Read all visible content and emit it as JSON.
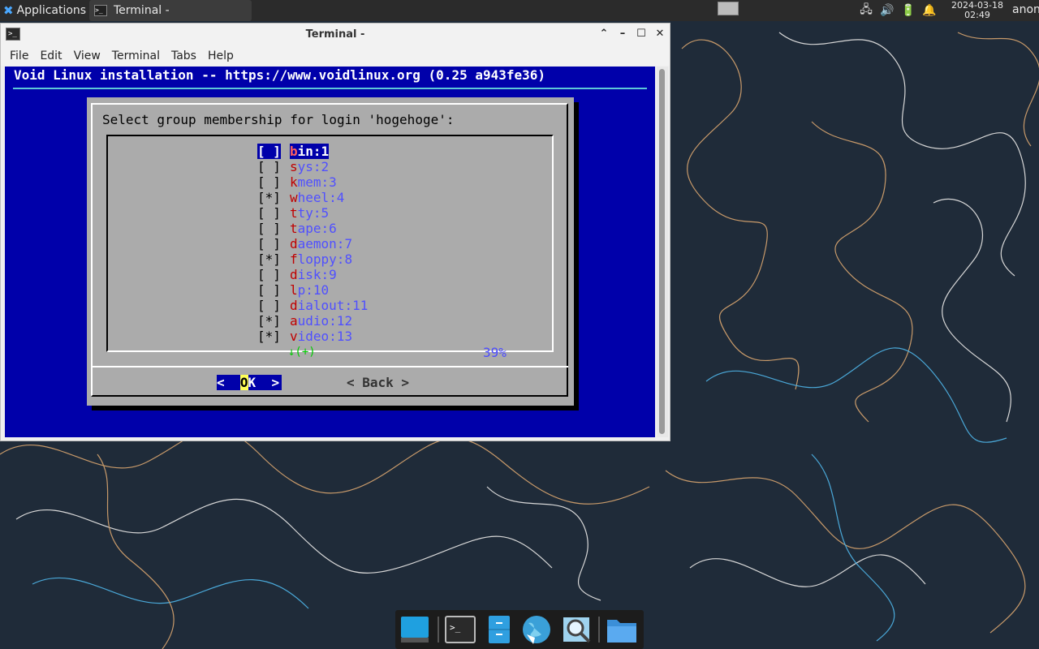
{
  "top_panel": {
    "applications_label": "Applications",
    "task_label": "Terminal -",
    "clock_date": "2024-03-18",
    "clock_time": "02:49",
    "user": "anon",
    "tray_icons": [
      "network-icon",
      "volume-icon",
      "battery-icon",
      "notification-bell-icon"
    ]
  },
  "window": {
    "title": "Terminal -",
    "menu": [
      "File",
      "Edit",
      "View",
      "Terminal",
      "Tabs",
      "Help"
    ]
  },
  "terminal": {
    "banner": "Void Linux installation -- https://www.voidlinux.org (0.25 a943fe36)",
    "dialog": {
      "prompt": "Select group membership for login 'hogehoge':",
      "items": [
        {
          "checked": false,
          "hotkey": "b",
          "rest": "in:1",
          "selected": true
        },
        {
          "checked": false,
          "hotkey": "s",
          "rest": "ys:2",
          "selected": false
        },
        {
          "checked": false,
          "hotkey": "k",
          "rest": "mem:3",
          "selected": false
        },
        {
          "checked": true,
          "hotkey": "w",
          "rest": "heel:4",
          "selected": false
        },
        {
          "checked": false,
          "hotkey": "t",
          "rest": "ty:5",
          "selected": false
        },
        {
          "checked": false,
          "hotkey": "t",
          "rest": "ape:6",
          "selected": false
        },
        {
          "checked": false,
          "hotkey": "d",
          "rest": "aemon:7",
          "selected": false
        },
        {
          "checked": true,
          "hotkey": "f",
          "rest": "loppy:8",
          "selected": false
        },
        {
          "checked": false,
          "hotkey": "d",
          "rest": "isk:9",
          "selected": false
        },
        {
          "checked": false,
          "hotkey": "l",
          "rest": "p:10",
          "selected": false
        },
        {
          "checked": false,
          "hotkey": "d",
          "rest": "ialout:11",
          "selected": false
        },
        {
          "checked": true,
          "hotkey": "a",
          "rest": "udio:12",
          "selected": false
        },
        {
          "checked": true,
          "hotkey": "v",
          "rest": "ideo:13",
          "selected": false
        }
      ],
      "more_indicator": "↓(+)",
      "scroll_percent": "39%",
      "ok_left": "<  ",
      "ok_hotkey": "O",
      "ok_right": "K  >",
      "back_label": "< Back >"
    }
  },
  "dock": {
    "items": [
      "show-desktop-icon",
      "terminal-icon",
      "file-manager-icon",
      "web-browser-icon",
      "app-finder-icon",
      "folder-icon"
    ]
  },
  "colors": {
    "terminal_bg": "#0000aa",
    "dialog_bg": "#ababab",
    "desktop_bg": "#1e2a38"
  }
}
